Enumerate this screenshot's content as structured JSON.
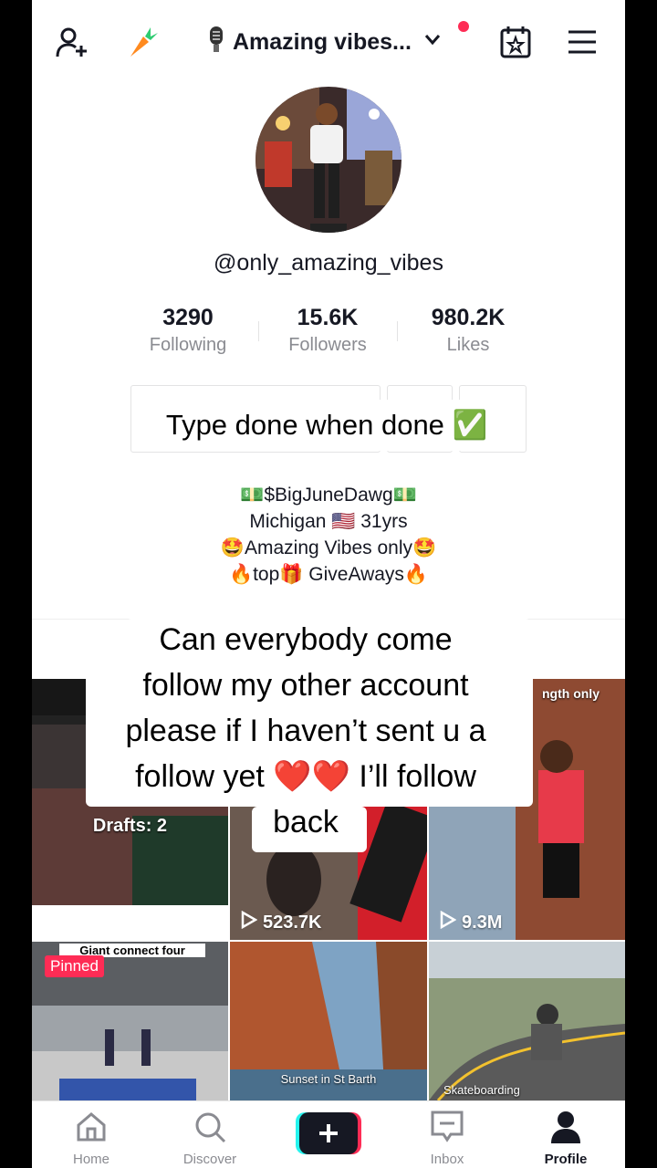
{
  "header": {
    "title": "Amazing vibes...",
    "mic_icon": "mic-icon",
    "add_user_icon": "add-user-icon",
    "carrot_icon": "carrot-icon",
    "calendar_icon": "calendar-star-icon",
    "menu_icon": "hamburger-menu-icon"
  },
  "profile": {
    "handle": "@only_amazing_vibes",
    "stats": [
      {
        "value": "3290",
        "label": "Following"
      },
      {
        "value": "15.6K",
        "label": "Followers"
      },
      {
        "value": "980.2K",
        "label": "Likes"
      }
    ],
    "bio": [
      "💵$BigJuneDawg💵",
      "Michigan 🇺🇸 31yrs",
      "🤩Amazing Vibes only🤩",
      "🔥top🎁 GiveAways🔥"
    ]
  },
  "overlay": {
    "top_caption": "Type done when done ✅",
    "main_caption_lines": [
      "Can everybody come",
      "follow my other account",
      "please if I haven’t sent u a",
      "follow yet ❤️❤️ I’ll follow",
      "back"
    ]
  },
  "grid": {
    "drafts_label": "Drafts: 2",
    "tiles": [
      {
        "views": "523.7K",
        "caption": ""
      },
      {
        "views": "9.3M",
        "caption": "ngth only"
      },
      {
        "caption": "Giant connect four",
        "badge": "Pinned"
      },
      {
        "caption": "Sunset in St Barth"
      },
      {
        "caption": "Skateboarding"
      }
    ]
  },
  "nav": [
    {
      "label": "Home",
      "icon": "home-icon"
    },
    {
      "label": "Discover",
      "icon": "search-icon"
    },
    {
      "label": "",
      "icon": "plus-icon"
    },
    {
      "label": "Inbox",
      "icon": "inbox-icon"
    },
    {
      "label": "Profile",
      "icon": "person-icon"
    }
  ],
  "colors": {
    "accent_red": "#fe2c55",
    "accent_cyan": "#25f4ee",
    "text_dark": "#161823",
    "text_gray": "#8a8b91"
  }
}
